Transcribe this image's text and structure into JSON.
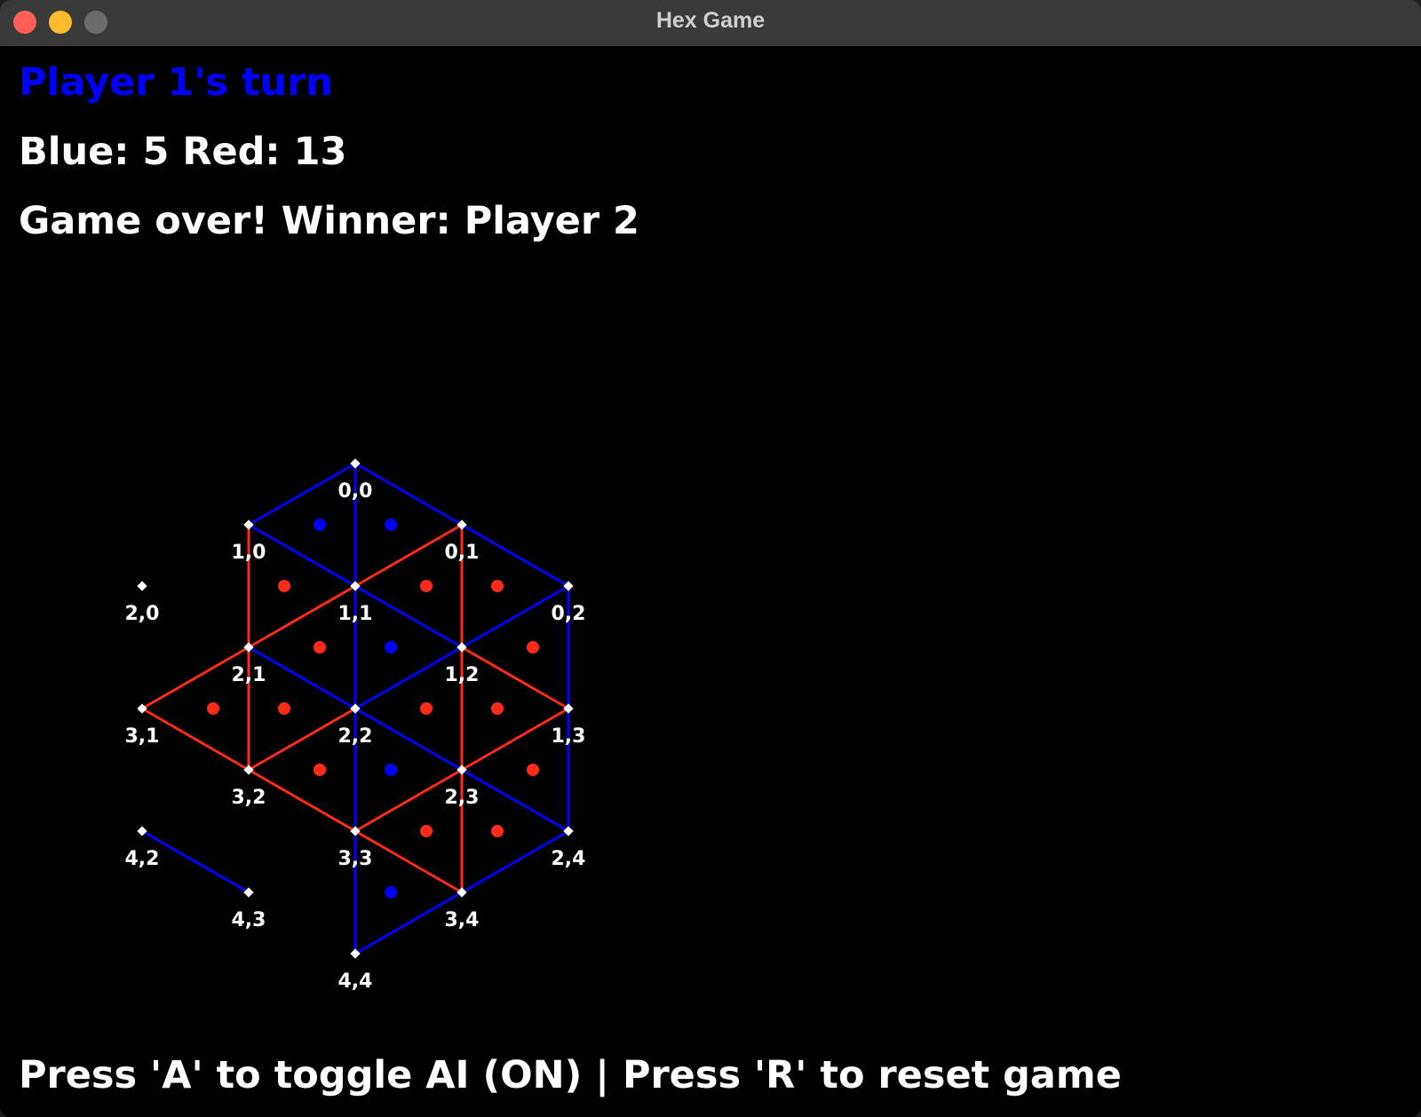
{
  "window": {
    "title": "Hex Game"
  },
  "status": {
    "turn_text": "Player 1's turn",
    "turn_color": "#0000ff",
    "score_text": "Blue: 5  Red: 13",
    "game_over_text": "Game over! Winner: Player 2"
  },
  "help": {
    "text": "Press 'A' to toggle AI (ON) | Press 'R' to reset game"
  },
  "colors": {
    "blue": "#0000ff",
    "red": "#ff2a1a",
    "node": "#ffffff",
    "background": "#000000"
  },
  "board": {
    "nodes": [
      {
        "id": "0,0",
        "label": "0,0"
      },
      {
        "id": "0,1",
        "label": "0,1"
      },
      {
        "id": "0,2",
        "label": "0,2"
      },
      {
        "id": "1,0",
        "label": "1,0"
      },
      {
        "id": "1,1",
        "label": "1,1"
      },
      {
        "id": "1,2",
        "label": "1,2"
      },
      {
        "id": "1,3",
        "label": "1,3"
      },
      {
        "id": "2,0",
        "label": "2,0"
      },
      {
        "id": "2,1",
        "label": "2,1"
      },
      {
        "id": "2,2",
        "label": "2,2"
      },
      {
        "id": "2,3",
        "label": "2,3"
      },
      {
        "id": "2,4",
        "label": "2,4"
      },
      {
        "id": "3,1",
        "label": "3,1"
      },
      {
        "id": "3,2",
        "label": "3,2"
      },
      {
        "id": "3,3",
        "label": "3,3"
      },
      {
        "id": "3,4",
        "label": "3,4"
      },
      {
        "id": "4,2",
        "label": "4,2"
      },
      {
        "id": "4,3",
        "label": "4,3"
      },
      {
        "id": "4,4",
        "label": "4,4"
      }
    ],
    "edges": [
      {
        "a": "0,0",
        "b": "0,1",
        "owner": "blue"
      },
      {
        "a": "0,1",
        "b": "0,2",
        "owner": "blue"
      },
      {
        "a": "0,2",
        "b": "1,3",
        "owner": "blue"
      },
      {
        "a": "1,3",
        "b": "2,4",
        "owner": "blue"
      },
      {
        "a": "2,4",
        "b": "3,4",
        "owner": "blue"
      },
      {
        "a": "3,4",
        "b": "4,4",
        "owner": "blue"
      },
      {
        "a": "0,0",
        "b": "1,0",
        "owner": "blue"
      },
      {
        "a": "0,2",
        "b": "1,2",
        "owner": "blue"
      },
      {
        "a": "1,2",
        "b": "2,2",
        "owner": "blue"
      },
      {
        "a": "0,0",
        "b": "1,1",
        "owner": "blue"
      },
      {
        "a": "1,1",
        "b": "2,2",
        "owner": "blue"
      },
      {
        "a": "2,2",
        "b": "3,3",
        "owner": "blue"
      },
      {
        "a": "3,3",
        "b": "4,4",
        "owner": "blue"
      },
      {
        "a": "1,0",
        "b": "1,1",
        "owner": "blue"
      },
      {
        "a": "1,1",
        "b": "1,2",
        "owner": "blue"
      },
      {
        "a": "2,1",
        "b": "2,2",
        "owner": "blue"
      },
      {
        "a": "2,2",
        "b": "2,3",
        "owner": "blue"
      },
      {
        "a": "2,3",
        "b": "2,4",
        "owner": "blue"
      },
      {
        "a": "4,2",
        "b": "4,3",
        "owner": "blue"
      },
      {
        "a": "0,1",
        "b": "1,1",
        "owner": "red"
      },
      {
        "a": "1,1",
        "b": "2,1",
        "owner": "red"
      },
      {
        "a": "2,1",
        "b": "3,1",
        "owner": "red"
      },
      {
        "a": "1,3",
        "b": "2,3",
        "owner": "red"
      },
      {
        "a": "2,3",
        "b": "3,3",
        "owner": "red"
      },
      {
        "a": "2,2",
        "b": "3,2",
        "owner": "red"
      },
      {
        "a": "0,1",
        "b": "1,2",
        "owner": "red"
      },
      {
        "a": "1,2",
        "b": "2,3",
        "owner": "red"
      },
      {
        "a": "2,3",
        "b": "3,4",
        "owner": "red"
      },
      {
        "a": "1,0",
        "b": "2,1",
        "owner": "red"
      },
      {
        "a": "2,1",
        "b": "3,2",
        "owner": "red"
      },
      {
        "a": "1,2",
        "b": "1,3",
        "owner": "red"
      },
      {
        "a": "3,1",
        "b": "3,2",
        "owner": "red"
      },
      {
        "a": "3,2",
        "b": "3,3",
        "owner": "red"
      },
      {
        "a": "3,3",
        "b": "3,4",
        "owner": "red"
      }
    ],
    "triangles": [
      {
        "nodes": [
          "0,0",
          "0,1",
          "1,1"
        ],
        "owner": "blue"
      },
      {
        "nodes": [
          "0,1",
          "1,1",
          "1,2"
        ],
        "owner": "red"
      },
      {
        "nodes": [
          "0,1",
          "0,2",
          "1,2"
        ],
        "owner": "red"
      },
      {
        "nodes": [
          "0,2",
          "1,2",
          "1,3"
        ],
        "owner": "red"
      },
      {
        "nodes": [
          "1,2",
          "1,3",
          "2,3"
        ],
        "owner": "red"
      },
      {
        "nodes": [
          "1,3",
          "2,3",
          "2,4"
        ],
        "owner": "red"
      },
      {
        "nodes": [
          "0,0",
          "1,0",
          "1,1"
        ],
        "owner": "blue"
      },
      {
        "nodes": [
          "1,1",
          "1,2",
          "2,2"
        ],
        "owner": "blue"
      },
      {
        "nodes": [
          "1,2",
          "2,2",
          "2,3"
        ],
        "owner": "red"
      },
      {
        "nodes": [
          "2,3",
          "2,4",
          "3,4"
        ],
        "owner": "red"
      },
      {
        "nodes": [
          "1,0",
          "1,1",
          "2,1"
        ],
        "owner": "red"
      },
      {
        "nodes": [
          "1,1",
          "2,1",
          "2,2"
        ],
        "owner": "red"
      },
      {
        "nodes": [
          "2,2",
          "2,3",
          "3,3"
        ],
        "owner": "blue"
      },
      {
        "nodes": [
          "2,3",
          "3,3",
          "3,4"
        ],
        "owner": "red"
      },
      {
        "nodes": [
          "2,1",
          "2,2",
          "3,2"
        ],
        "owner": "red"
      },
      {
        "nodes": [
          "2,2",
          "3,2",
          "3,3"
        ],
        "owner": "red"
      },
      {
        "nodes": [
          "3,3",
          "3,4",
          "4,4"
        ],
        "owner": "blue"
      },
      {
        "nodes": [
          "2,1",
          "3,1",
          "3,2"
        ],
        "owner": "red"
      }
    ]
  }
}
